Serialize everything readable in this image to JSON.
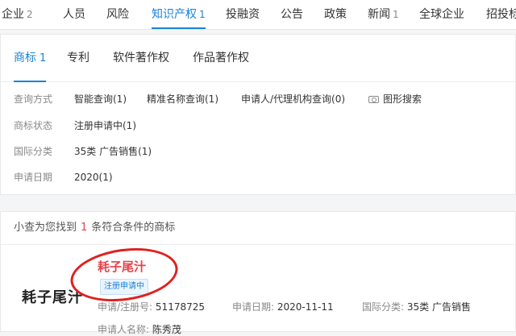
{
  "top_tabs": [
    {
      "label": "企业",
      "count": "2"
    },
    {
      "label": "人员",
      "count": ""
    },
    {
      "label": "风险",
      "count": ""
    },
    {
      "label": "知识产权",
      "count": "1"
    },
    {
      "label": "投融资",
      "count": ""
    },
    {
      "label": "公告",
      "count": ""
    },
    {
      "label": "政策",
      "count": ""
    },
    {
      "label": "新闻",
      "count": "1"
    },
    {
      "label": "全球企业",
      "count": ""
    },
    {
      "label": "招投标",
      "count": ""
    }
  ],
  "sub_tabs": [
    {
      "label": "商标",
      "count": "1"
    },
    {
      "label": "专利",
      "count": ""
    },
    {
      "label": "软件著作权",
      "count": ""
    },
    {
      "label": "作品著作权",
      "count": ""
    }
  ],
  "filters": {
    "query_method": {
      "label": "查询方式",
      "options": [
        "智能查询(1)",
        "精准名称查询(1)",
        "申请人/代理机构查询(0)",
        "图形搜索"
      ]
    },
    "status": {
      "label": "商标状态",
      "options": [
        "注册申请中(1)"
      ]
    },
    "intl_class": {
      "label": "国际分类",
      "options": [
        "35类 广告销售(1)"
      ]
    },
    "apply_date": {
      "label": "申请日期",
      "options": [
        "2020(1)"
      ]
    }
  },
  "result_summary": {
    "prefix": "小查为您找到",
    "count": "1",
    "suffix": "条符合条件的商标"
  },
  "trademark": {
    "logo_text": "耗子尾汁",
    "name": "耗子尾汁",
    "status": "注册申请中",
    "reg_no_label": "申请/注册号:",
    "reg_no": "51178725",
    "apply_date_label": "申请日期:",
    "apply_date": "2020-11-11",
    "intl_class_label": "国际分类:",
    "intl_class": "35类 广告销售",
    "applicant_label": "申请人名称:",
    "applicant": "陈秀茂"
  },
  "colors": {
    "accent": "#1a82d9",
    "highlight": "#e8424a",
    "annotation": "#e02020"
  }
}
